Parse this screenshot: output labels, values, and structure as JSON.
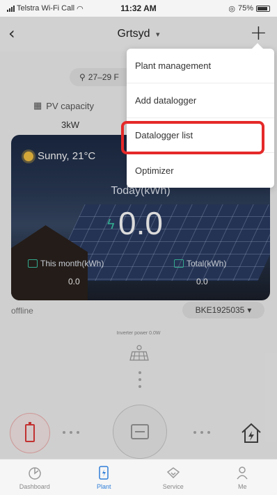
{
  "status_bar": {
    "carrier": "Telstra Wi-Fi Call",
    "time": "11:32 AM",
    "battery": "75%"
  },
  "nav": {
    "back_icon": "chevron-left-icon",
    "title": "Grtsyd",
    "caret": "▾",
    "add_icon": "plus-icon"
  },
  "date_range": "27–29 F",
  "pv": {
    "label": "PV capacity",
    "value": "3kW"
  },
  "card": {
    "weather": "Sunny,  21°C",
    "today_label": "Today(kWh)",
    "today_value": "0.0",
    "month_label": "This month(kWh)",
    "month_value": "0.0",
    "total_label": "Total(kWh)",
    "total_value": "0.0"
  },
  "status": "offline",
  "device": "BKE1925035",
  "inverter_power": "Inverter power 0.0W",
  "dropdown": {
    "items": [
      "Plant management",
      "Add datalogger",
      "Datalogger list",
      "Optimizer"
    ],
    "highlighted": "Datalogger list",
    "highlight_color": "#e52929"
  },
  "tabs": [
    {
      "label": "Dashboard",
      "icon": "dashboard-icon"
    },
    {
      "label": "Plant",
      "icon": "plant-icon",
      "active": true
    },
    {
      "label": "Service",
      "icon": "service-icon"
    },
    {
      "label": "Me",
      "icon": "me-icon"
    }
  ],
  "colors": {
    "accent": "#2f7ed8",
    "battery_red": "#e23a3a",
    "energy_green": "#3cc6a8"
  }
}
